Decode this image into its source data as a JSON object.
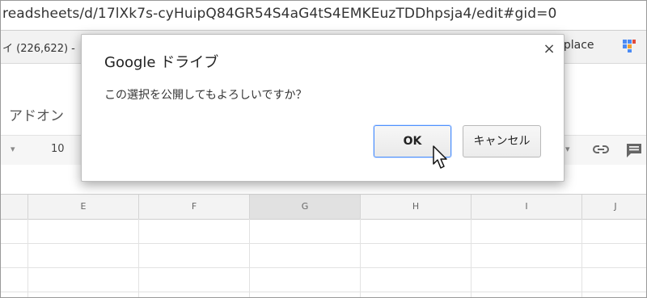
{
  "browser": {
    "url": "readsheets/d/17lXk7s-cyHuipQ84GR54S4aG4tS4EMKEuzTDDhpsja4/edit#gid=0",
    "bookmark_left": "イ (226,622) -",
    "bookmark_right": "rkplace",
    "bookmark_favicon": "workplace-icon"
  },
  "sheets": {
    "menu_addons": "アドオン",
    "toolbar": {
      "font_size": "10",
      "link_icon": "link-icon",
      "comment_icon": "comment-icon"
    },
    "columns": [
      "E",
      "F",
      "G",
      "H",
      "I",
      "J"
    ],
    "selected_column": "G"
  },
  "dialog": {
    "title": "Google ドライブ",
    "message": "この選択を公開してもよろしいですか？",
    "close_label": "×",
    "ok_label": "OK",
    "cancel_label": "キャンセル"
  },
  "colors": {
    "ok_border": "#4d90fe",
    "favicon": [
      "#4b8bf5",
      "#f0a030",
      "#e24b3b"
    ]
  }
}
